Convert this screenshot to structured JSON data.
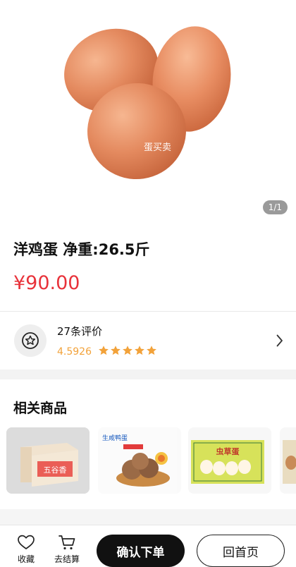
{
  "product": {
    "image_watermark": "蛋买卖",
    "image_pager": "1/1",
    "title": "洋鸡蛋 净重:26.5斤",
    "price": "¥90.00"
  },
  "review": {
    "count_label": "27条评价",
    "score": "4.5926",
    "stars_filled": 5,
    "stars_total": 5,
    "icon": "star-circle-icon"
  },
  "related": {
    "title": "相关商品",
    "items": [
      {
        "label": "五谷香",
        "kind": "egg-box"
      },
      {
        "label": "生咸鸭蛋",
        "kind": "salted-duck-eggs"
      },
      {
        "label": "虫草蛋",
        "kind": "cordyceps-eggs"
      },
      {
        "label": "",
        "kind": "egg-pack"
      }
    ]
  },
  "bottom_bar": {
    "favorite_label": "收藏",
    "cart_label": "去结算",
    "confirm_label": "确认下单",
    "home_label": "回首页"
  },
  "colors": {
    "price": "#e8323a",
    "score": "#f2a23a",
    "primary_button": "#111111"
  }
}
